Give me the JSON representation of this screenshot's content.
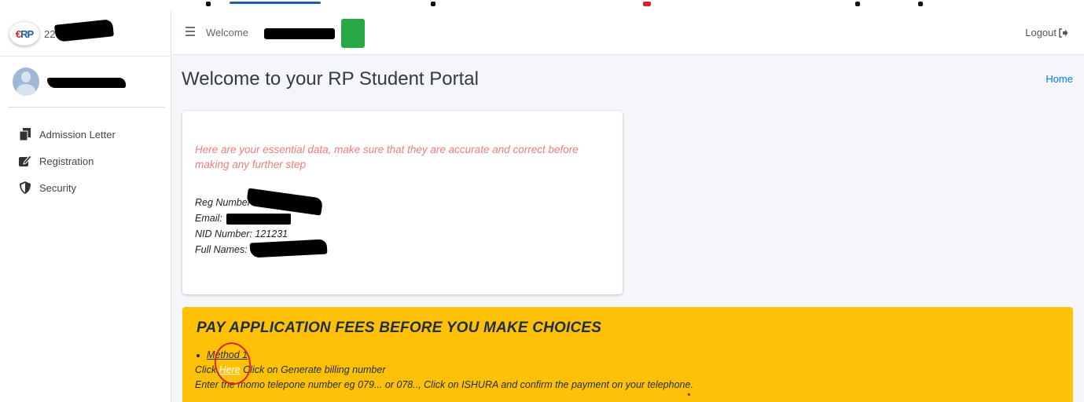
{
  "brand": {
    "logo_text_1": "RP",
    "name_fragment": "22"
  },
  "sidebar": {
    "items": [
      {
        "label": "Admission Letter",
        "icon": "documents-icon"
      },
      {
        "label": "Registration",
        "icon": "edit-icon"
      },
      {
        "label": "Security",
        "icon": "shield-icon"
      }
    ]
  },
  "topbar": {
    "welcome": "Welcome",
    "logout": "Logout"
  },
  "header": {
    "title": "Welcome to your RP Student Portal",
    "home": "Home"
  },
  "card": {
    "intro": "Here are your essential data, make sure that they are accurate and correct before making any further step",
    "reg_label": "Reg Number",
    "email_label": "Email:",
    "nid_label": "NID Number: 121231",
    "names_label": "Full Names:"
  },
  "warning": {
    "title": "PAY APPLICATION FEES BEFORE YOU MAKE CHOICES",
    "method": "Method 1",
    "click_prefix": "Click",
    "here": "Here",
    "click_suffix": "Click on Generate billing number",
    "instruction": "Enter the momo telepone number eg 079... or 078.., Click on ISHURA and confirm the payment on your telephone."
  },
  "colors": {
    "accent": "#007bff",
    "warning": "#ffc107",
    "success": "#28a745",
    "intro_text": "#f07c7c"
  }
}
